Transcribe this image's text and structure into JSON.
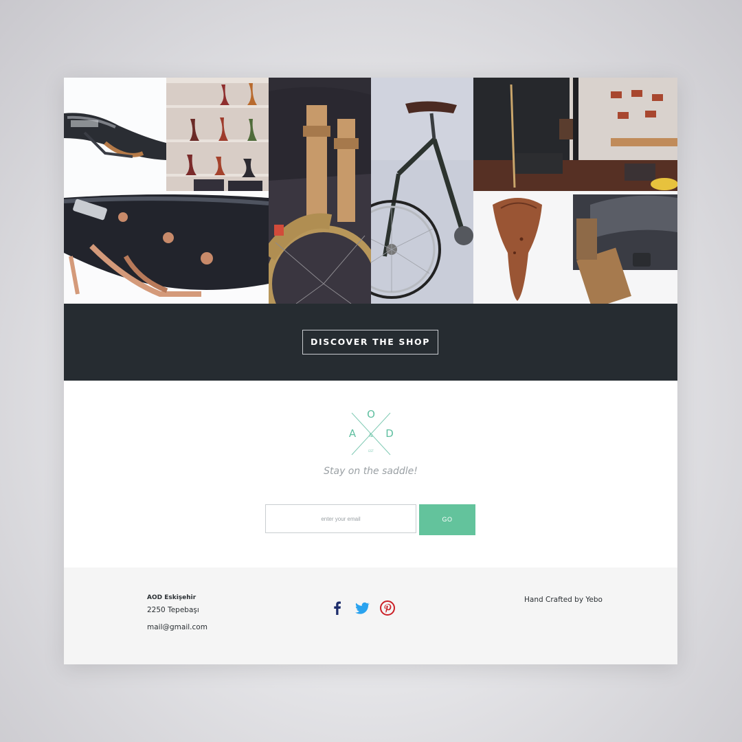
{
  "gallery": {
    "images": [
      {
        "name": "brooks-saddle-black-photo",
        "alt": "saddle"
      },
      {
        "name": "saddle-wall-display-photo",
        "alt": "saddles on wall"
      },
      {
        "name": "bike-bag-photo",
        "alt": "bag on bike"
      },
      {
        "name": "road-bike-photo",
        "alt": "bicycle"
      },
      {
        "name": "shop-interior-photo",
        "alt": "shop interior"
      },
      {
        "name": "brooks-saddle-closeup-photo",
        "alt": "saddle detail"
      },
      {
        "name": "tan-saddle-and-bag-photo",
        "alt": "tan saddle and bag"
      }
    ]
  },
  "cta": {
    "label": "DISCOVER THE SHOP"
  },
  "newsletter": {
    "logo": {
      "top": "O",
      "left": "A",
      "right": "D",
      "mid": "&",
      "small": "EST"
    },
    "tagline": "Stay on the saddle!",
    "email_placeholder": "enter your email",
    "submit_label": "GO"
  },
  "footer": {
    "address_name": "AOD Eskişehir",
    "address_line": "2250 Tepebaşı",
    "email": "mail@gmail.com",
    "social": [
      {
        "name": "facebook-icon",
        "color": "#1d2d6b"
      },
      {
        "name": "twitter-icon",
        "color": "#2aa3ef"
      },
      {
        "name": "pinterest-icon",
        "color": "#cb2027"
      }
    ],
    "credit": "Hand Crafted by Yebo"
  },
  "colors": {
    "dark_band": "#262c31",
    "accent_green": "#63c39c",
    "footer_bg": "#f5f5f5"
  }
}
